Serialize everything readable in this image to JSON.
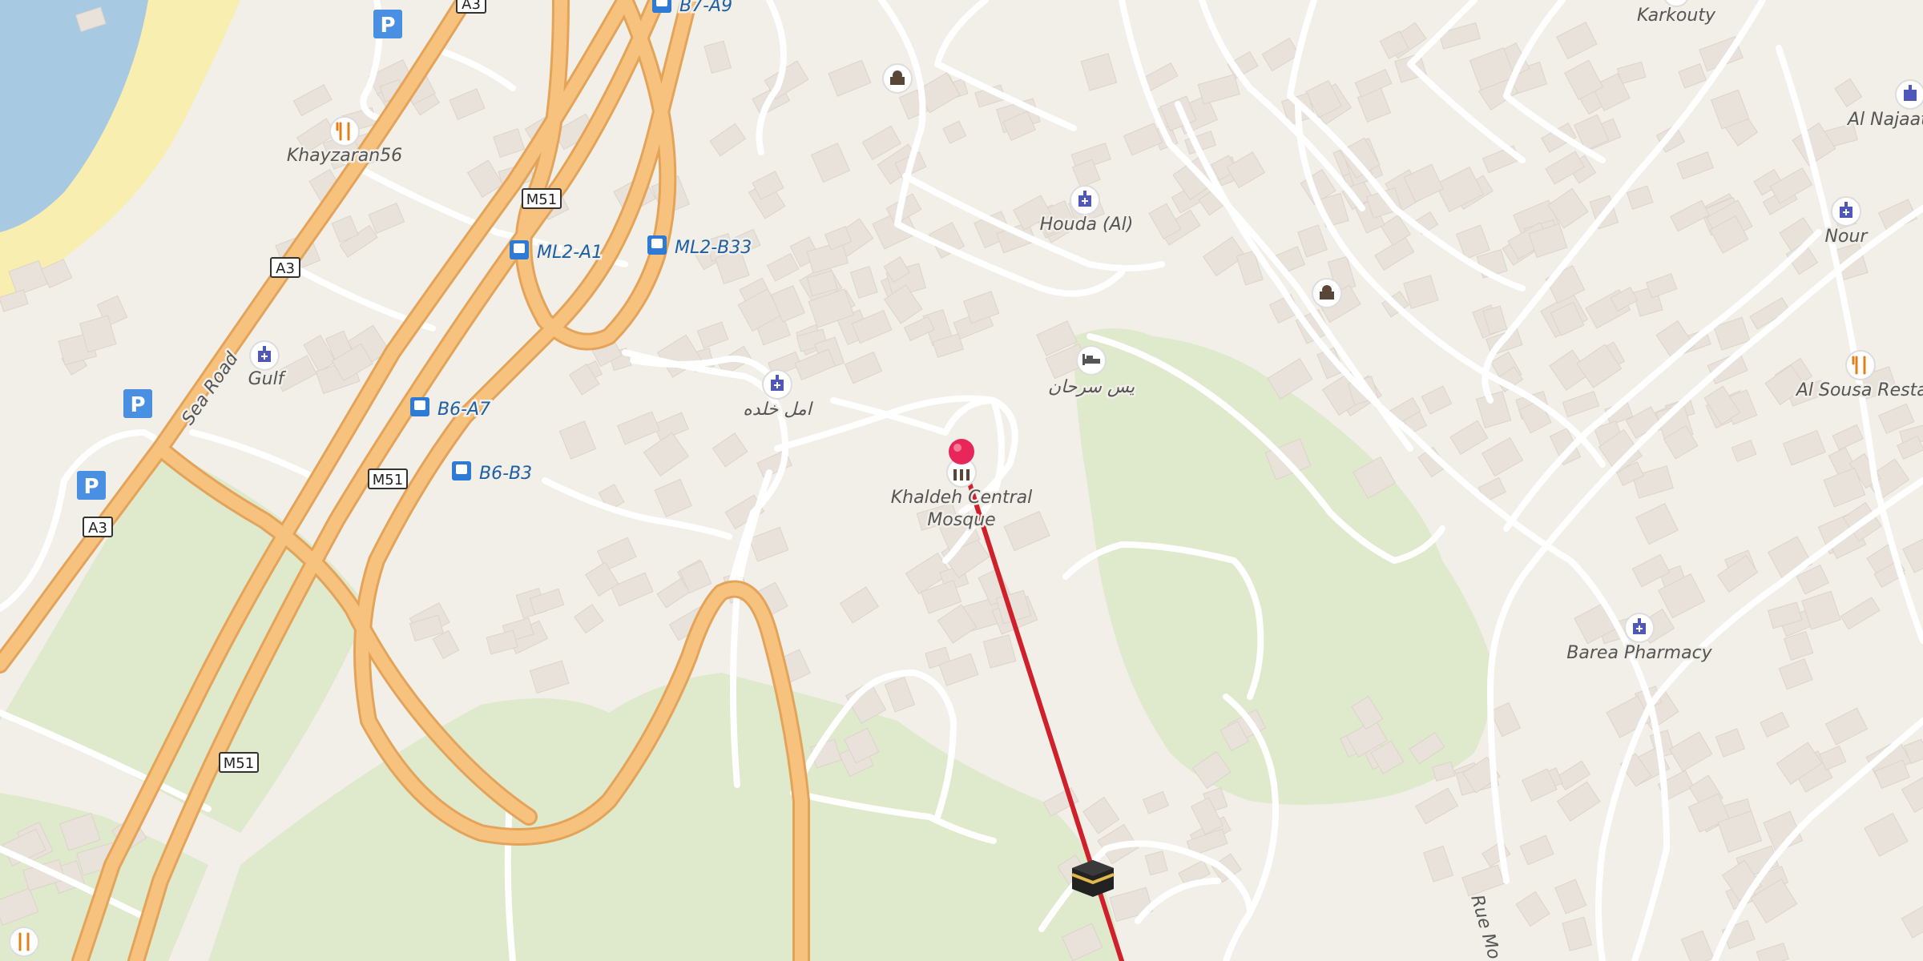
{
  "map": {
    "colors": {
      "land": "#f2efe9",
      "water": "#a8c9e2",
      "beach": "#f7eeb0",
      "park": "#dfe9cb",
      "building": "#e8e2da",
      "road_minor": "#ffffff",
      "road_major": "#f7c27e",
      "road_major_casing": "#e3a45a",
      "route_line": "#d0202c",
      "pin": "#e8265a",
      "parking": "#4a90e2",
      "pharmacy_icon": "#4f58b8",
      "restaurant_icon": "#e0801a"
    },
    "road_shields": [
      {
        "id": "a3-top",
        "text": "A3"
      },
      {
        "id": "m51-1",
        "text": "M51"
      },
      {
        "id": "a3-mid",
        "text": "A3"
      },
      {
        "id": "m51-2",
        "text": "M51"
      },
      {
        "id": "a3-low",
        "text": "A3"
      },
      {
        "id": "m51-3",
        "text": "M51"
      }
    ],
    "road_names": {
      "sea_road": "Sea Road",
      "rue_mo": "Rue Mo"
    },
    "bus_stops": [
      {
        "id": "b7-a9",
        "text": "B7-A9"
      },
      {
        "id": "ml2-a1",
        "text": "ML2-A1"
      },
      {
        "id": "ml2-b33",
        "text": "ML2-B33"
      },
      {
        "id": "b6-a7",
        "text": "B6-A7"
      },
      {
        "id": "b6-b3",
        "text": "B6-B3"
      }
    ],
    "pois": {
      "khayzaran": "Khayzaran56",
      "gulf": "Gulf",
      "houda": "Houda (Al)",
      "amal_khaldeh": "امل خلده",
      "hotel": "يس سرحان",
      "mosque_line1": "Khaldeh Central",
      "mosque_line2": "Mosque",
      "karkouty": "Karkouty",
      "al_najaat": "Al Najaat P",
      "nour": "Nour",
      "al_sousa": "Al Sousa  Restauro",
      "barea": "Barea Pharmacy"
    },
    "parking_label": "P"
  }
}
